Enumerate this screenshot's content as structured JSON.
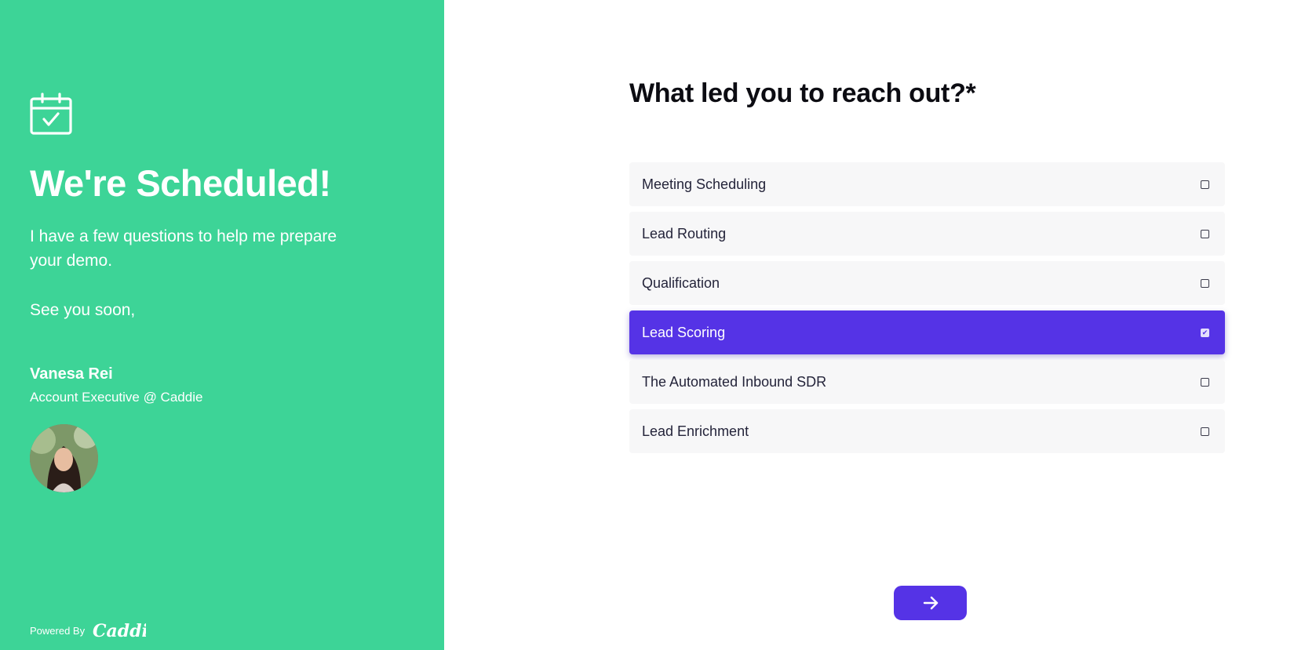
{
  "left_panel": {
    "background_color": "#3dd497",
    "icon": "calendar-check-icon",
    "headline": "We're Scheduled!",
    "intro": "I have a few questions to help me prepare your demo.",
    "signoff": "See you soon,",
    "rep": {
      "name": "Vanesa Rei",
      "title": "Account Executive @ Caddie",
      "avatar": "avatar-photo"
    },
    "footer": {
      "powered_by": "Powered By",
      "logo_text": "Caddie"
    }
  },
  "form": {
    "question": "What led you to reach out?*",
    "accent_color": "#5533e6",
    "options": [
      {
        "label": "Meeting Scheduling",
        "selected": false
      },
      {
        "label": "Lead Routing",
        "selected": false
      },
      {
        "label": "Qualification",
        "selected": false
      },
      {
        "label": "Lead Scoring",
        "selected": true
      },
      {
        "label": "The Automated Inbound SDR",
        "selected": false
      },
      {
        "label": "Lead Enrichment",
        "selected": false
      }
    ],
    "next_button_icon": "arrow-right-icon"
  }
}
